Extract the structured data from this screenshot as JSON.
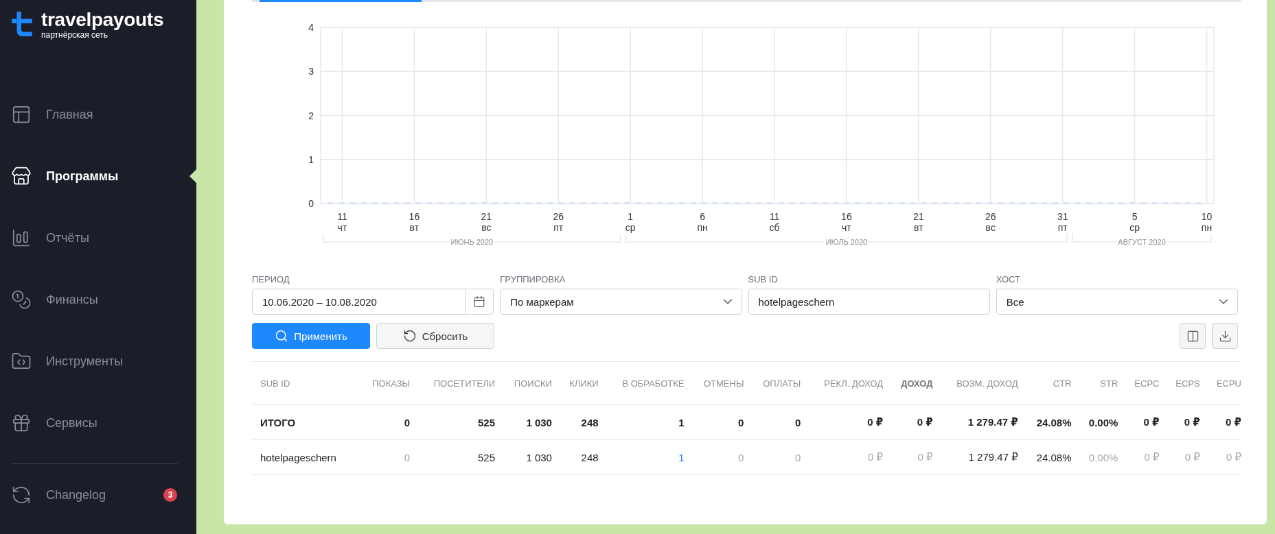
{
  "sidebar": {
    "logo": {
      "name": "travelpayouts",
      "tagline": "партнёрская сеть"
    },
    "items": [
      {
        "label": "Главная",
        "selected": false
      },
      {
        "label": "Программы",
        "selected": true
      },
      {
        "label": "Отчёты",
        "selected": false
      },
      {
        "label": "Финансы",
        "selected": false
      },
      {
        "label": "Инструменты",
        "selected": false
      },
      {
        "label": "Сервисы",
        "selected": false
      }
    ],
    "footer_items": [
      {
        "label": "Changelog",
        "badge": "3"
      }
    ]
  },
  "chart": {
    "chart_data": {
      "type": "line",
      "grid": true,
      "ylim": [
        0,
        4
      ],
      "yticks": [
        0,
        1,
        2,
        3,
        4
      ],
      "categories": [
        null,
        "11 чт",
        null,
        null,
        null,
        null,
        "16 вт",
        null,
        null,
        null,
        null,
        "21 вс",
        null,
        null,
        null,
        null,
        "26 пт",
        null,
        null,
        null,
        null,
        "1 ср",
        null,
        null,
        null,
        null,
        "6 пн",
        null,
        null,
        null,
        null,
        "11 сб",
        null,
        null,
        null,
        null,
        "16 чт",
        null,
        null,
        null,
        null,
        "21 вт",
        null,
        null,
        null,
        null,
        "26 вс",
        null,
        null,
        null,
        null,
        "31 пт",
        null,
        null,
        null,
        null,
        "5 ср",
        null,
        null,
        null,
        null,
        "10 пн"
      ],
      "series": [
        {
          "color": "#cfe3fb",
          "line_style": "dashed",
          "values": [
            0,
            0,
            0,
            0,
            0,
            0,
            0,
            0,
            0,
            0,
            0,
            0,
            0,
            0,
            0,
            0,
            0,
            0,
            0,
            0,
            0,
            0,
            0,
            0,
            0,
            0,
            0,
            0,
            0,
            0,
            0,
            0,
            0,
            0,
            0,
            0,
            0,
            0,
            0,
            0,
            0,
            0,
            0,
            0,
            0,
            0,
            0,
            0,
            0,
            0,
            0,
            0,
            0,
            0,
            0,
            0,
            0,
            0,
            0,
            0,
            0,
            0
          ]
        }
      ],
      "legend": null
    },
    "months": [
      "ИЮНЬ 2020",
      "ИЮЛЬ 2020",
      "АВГУСТ 2020"
    ]
  },
  "filters": [
    {
      "label": "ПЕРИОД",
      "value": "10.06.2020 – 10.08.2020",
      "kind": "date"
    },
    {
      "label": "ГРУППИРОВКА",
      "value": "По маркерам",
      "kind": "select"
    },
    {
      "label": "SUB ID",
      "value": "hotelpageschern",
      "kind": "text"
    },
    {
      "label": "ХОСТ",
      "value": "Все",
      "kind": "select"
    }
  ],
  "actions": [
    {
      "label": "Применить",
      "kind": "primary"
    },
    {
      "label": "Сбросить",
      "kind": "secondary"
    }
  ],
  "table": {
    "columns": [
      {
        "label": "SUB ID",
        "bold": false
      },
      {
        "label": "ПОКАЗЫ",
        "bold": false
      },
      {
        "label": "ПОСЕТИТЕЛИ",
        "bold": false
      },
      {
        "label": "ПОИСКИ",
        "bold": false
      },
      {
        "label": "КЛИКИ",
        "bold": false
      },
      {
        "label": "В ОБРАБОТКЕ",
        "bold": false
      },
      {
        "label": "ОТМЕНЫ",
        "bold": false
      },
      {
        "label": "ОПЛАТЫ",
        "bold": false
      },
      {
        "label": "РЕКЛ. ДОХОД",
        "bold": false
      },
      {
        "label": "ДОХОД",
        "bold": true
      },
      {
        "label": "ВОЗМ. ДОХОД",
        "bold": false
      },
      {
        "label": "CTR",
        "bold": false
      },
      {
        "label": "STR",
        "bold": false
      },
      {
        "label": "ECPC",
        "bold": false
      },
      {
        "label": "ECPS",
        "bold": false
      },
      {
        "label": "ECPU",
        "bold": false
      }
    ],
    "rows": [
      {
        "kind": "total",
        "cells": [
          {
            "text": "ИТОГО",
            "muted": false,
            "link": false
          },
          {
            "text": "0",
            "muted": false,
            "link": false
          },
          {
            "text": "525",
            "muted": false,
            "link": false
          },
          {
            "text": "1 030",
            "muted": false,
            "link": false
          },
          {
            "text": "248",
            "muted": false,
            "link": false
          },
          {
            "text": "1",
            "muted": false,
            "link": false
          },
          {
            "text": "0",
            "muted": false,
            "link": false
          },
          {
            "text": "0",
            "muted": false,
            "link": false
          },
          {
            "text": "0 ₽",
            "muted": false,
            "link": false
          },
          {
            "text": "0 ₽",
            "muted": false,
            "link": false
          },
          {
            "text": "1 279.47 ₽",
            "muted": false,
            "link": false
          },
          {
            "text": "24.08%",
            "muted": false,
            "link": false
          },
          {
            "text": "0.00%",
            "muted": false,
            "link": false
          },
          {
            "text": "0 ₽",
            "muted": false,
            "link": false
          },
          {
            "text": "0 ₽",
            "muted": false,
            "link": false
          },
          {
            "text": "0 ₽",
            "muted": false,
            "link": false
          }
        ]
      },
      {
        "kind": "item",
        "cells": [
          {
            "text": "hotelpageschern",
            "muted": false,
            "link": false
          },
          {
            "text": "0",
            "muted": true,
            "link": false
          },
          {
            "text": "525",
            "muted": false,
            "link": false
          },
          {
            "text": "1 030",
            "muted": false,
            "link": false
          },
          {
            "text": "248",
            "muted": false,
            "link": false
          },
          {
            "text": "1",
            "muted": false,
            "link": true
          },
          {
            "text": "0",
            "muted": true,
            "link": false
          },
          {
            "text": "0",
            "muted": true,
            "link": false
          },
          {
            "text": "0 ₽",
            "muted": true,
            "link": false
          },
          {
            "text": "0 ₽",
            "muted": true,
            "link": false
          },
          {
            "text": "1 279.47 ₽",
            "muted": false,
            "link": false
          },
          {
            "text": "24.08%",
            "muted": false,
            "link": false
          },
          {
            "text": "0.00%",
            "muted": true,
            "link": false
          },
          {
            "text": "0 ₽",
            "muted": true,
            "link": false
          },
          {
            "text": "0 ₽",
            "muted": true,
            "link": false
          },
          {
            "text": "0 ₽",
            "muted": true,
            "link": false
          }
        ]
      }
    ]
  }
}
